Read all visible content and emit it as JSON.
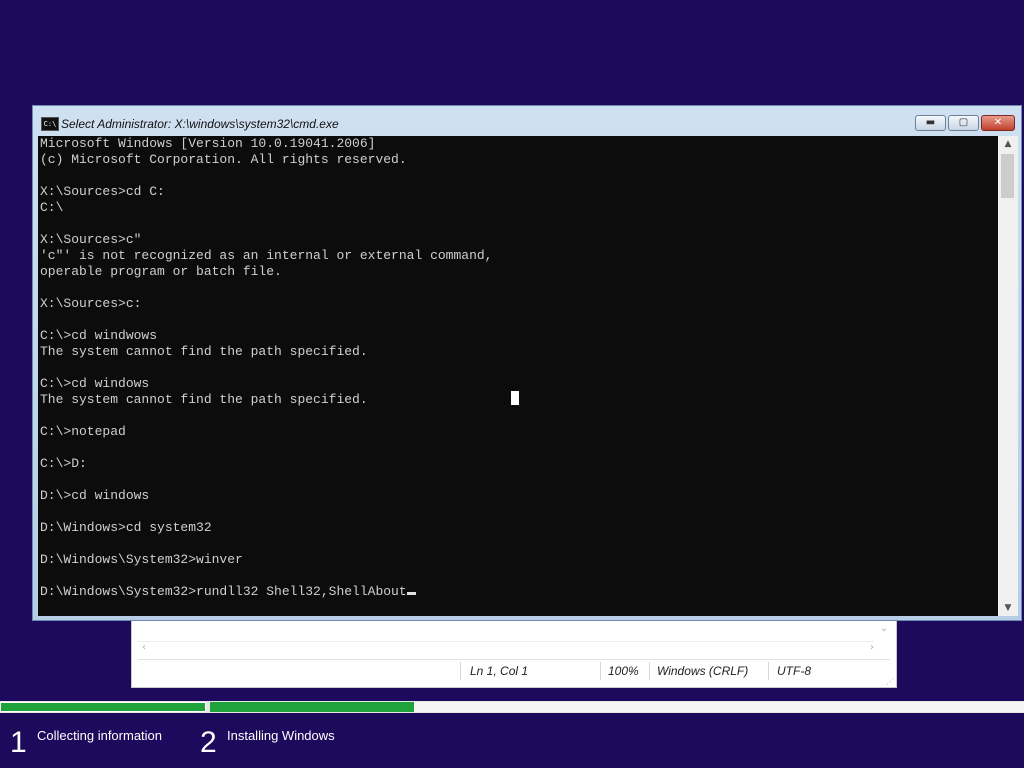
{
  "notepad": {
    "status": {
      "position": "Ln 1, Col 1",
      "zoom": "100%",
      "line_endings": "Windows (CRLF)",
      "encoding": "UTF-8"
    }
  },
  "cmd": {
    "icon_text": "C:\\",
    "title": "Select Administrator: X:\\windows\\system32\\cmd.exe",
    "buttons": {
      "minimize": "▬",
      "maximize": "▢",
      "close": "✕"
    },
    "lines": [
      "Microsoft Windows [Version 10.0.19041.2006]",
      "(c) Microsoft Corporation. All rights reserved.",
      "",
      "X:\\Sources>cd C:",
      "C:\\",
      "",
      "X:\\Sources>c\"",
      "'c\"' is not recognized as an internal or external command,",
      "operable program or batch file.",
      "",
      "X:\\Sources>c:",
      "",
      "C:\\>cd windwows",
      "The system cannot find the path specified.",
      "",
      "C:\\>cd windows",
      "The system cannot find the path specified.",
      "",
      "C:\\>notepad",
      "",
      "C:\\>D:",
      "",
      "D:\\>cd windows",
      "",
      "D:\\Windows>cd system32",
      "",
      "D:\\Windows\\System32>winver",
      ""
    ],
    "current_line": "D:\\Windows\\System32>rundll32 Shell32,ShellAbout"
  },
  "setup": {
    "steps": [
      {
        "number": "1",
        "label": "Collecting information"
      },
      {
        "number": "2",
        "label": "Installing Windows"
      }
    ],
    "progress": {
      "step1_fraction": 1.0,
      "step2_fraction": 0.25
    },
    "colors": {
      "background": "#1e0a5c",
      "progress": "#1fa23b"
    }
  }
}
